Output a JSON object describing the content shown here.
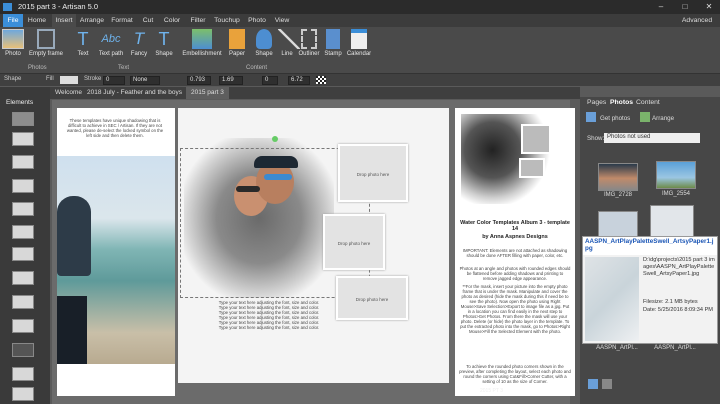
{
  "window": {
    "title": "2015 part 3 - Artisan 5.0",
    "advanced": "Advanced"
  },
  "menu": [
    "File",
    "Home",
    "Insert",
    "Arrange",
    "Format",
    "Cut",
    "Color",
    "Filter",
    "Touchup",
    "Photo",
    "View"
  ],
  "ribbon": {
    "buttons": [
      "Photo",
      "Empty frame",
      "Text",
      "Text path",
      "Fancy",
      "Shape",
      "Embellishment",
      "Paper",
      "Shape",
      "Line",
      "Outliner",
      "Stamp",
      "Calendar"
    ],
    "groups": [
      "Photos",
      "Text",
      "Content"
    ]
  },
  "props": {
    "shape": "Shape",
    "fill": "Fill",
    "stroke": "Stroke",
    "stroke_val": "0",
    "none": "None",
    "w": "0.793",
    "h": "1.69",
    "rot": "0",
    "zoom": "6.72"
  },
  "doc_tabs": [
    "Welcome",
    "2018 July - Feather and the boys",
    "2015 part 3"
  ],
  "left_panel": {
    "title": "Elements"
  },
  "page1": {
    "notice": "These templates have unique shadowing that is difficult to achieve in SEC / Artisan. If they are not wanted, please de-select the locked symbol on the left side and then delete them."
  },
  "page2": {
    "drop": "Drop photo here",
    "body": "Type your text here adjusting the font, size and color.",
    "title": "2015 PT 3"
  },
  "page3": {
    "title": "Water Color Templates Album 3 - template 14",
    "author": "by Anna Aspnes Designs",
    "important": "IMPORTANT: Elements are not attached as shadowing should be done AFTER filling with paper, color, etc.",
    "p1": "Photos at an angle and photos with rounded edges should be flattened before adding shadows and printing to remove jagged edge appearance.",
    "p2": "**For the mask, insert your picture into the empty photo frame that is under the mask. Manipulate and cover the photo as desired (hide the mask during this if need be to see the photo). Now open the photo using Right Mouse>Save Selection>Export to image file as a jpg. Put in a location you can find easily in the next step to Photos>Get Photos. From there the mask will use your photo. Delete (or hide) the photo layer in the template. To put the extracted photo into the mask, go to Photos>Right Mouse>Fill the Selected Element with the photo.",
    "p3": "To achieve the rounded photo corners shown in the preview, after completing the layout, select each photo and round the corners using Cut&Fill>Corner Cutter, with a setting of 10 as the size of Corner."
  },
  "right_panel": {
    "tabs": [
      "Pages",
      "Photos",
      "Content"
    ],
    "get_photos": "Get photos",
    "arrange": "Arrange",
    "show_label": "Show:",
    "show_value": "Photos not used",
    "photos": [
      {
        "name": "IMG_2728"
      },
      {
        "name": "IMG_2554"
      },
      {
        "name": ""
      },
      {
        "name": ""
      },
      {
        "name": "AASPN_ArtPl..."
      },
      {
        "name": "AASPN_ArtPl..."
      }
    ]
  },
  "tooltip": {
    "title": "AASPN_ArtPlayPaletteSwell_ArtsyPaper1.jpg",
    "path": "D:\\dg\\projects\\2015 part 3 images\\AASPN_ArtPlayPaletteSwell_ArtsyPaper1.jpg",
    "filesize": "Filesize: 2.1 MB bytes",
    "date": "Date: 5/25/2016 8:09:34 PM"
  },
  "colors": {
    "accent": "#3b8ed8",
    "ribbon": "#4a4a4a"
  }
}
